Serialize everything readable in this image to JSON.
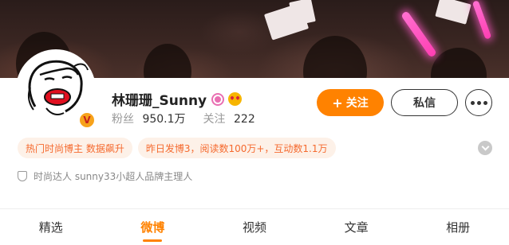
{
  "profile": {
    "name": "林珊珊_Sunny",
    "badges": [
      "pink-badge-icon",
      "heart-eyes-icon"
    ],
    "verified_badge": "V",
    "stats": [
      {
        "label": "粉丝",
        "value": "950.1万"
      },
      {
        "label": "关注",
        "value": "222"
      }
    ]
  },
  "actions": {
    "follow_plus": "+",
    "follow_label": "关注",
    "message_label": "私信"
  },
  "tags": [
    "热门时尚博主 数据飙升",
    "昨日发博3，阅读数100万+，互动数1.1万"
  ],
  "verified_text": "时尚达人 sunny33小超人品牌主理人",
  "tabs": [
    {
      "label": "精选",
      "active": false
    },
    {
      "label": "微博",
      "active": true
    },
    {
      "label": "视频",
      "active": false
    },
    {
      "label": "文章",
      "active": false
    },
    {
      "label": "相册",
      "active": false
    }
  ],
  "colors": {
    "accent": "#ff8200",
    "tag_bg": "#fdf1e8",
    "tag_text": "#f56a2f",
    "verified_gold": "#f7a21b"
  }
}
